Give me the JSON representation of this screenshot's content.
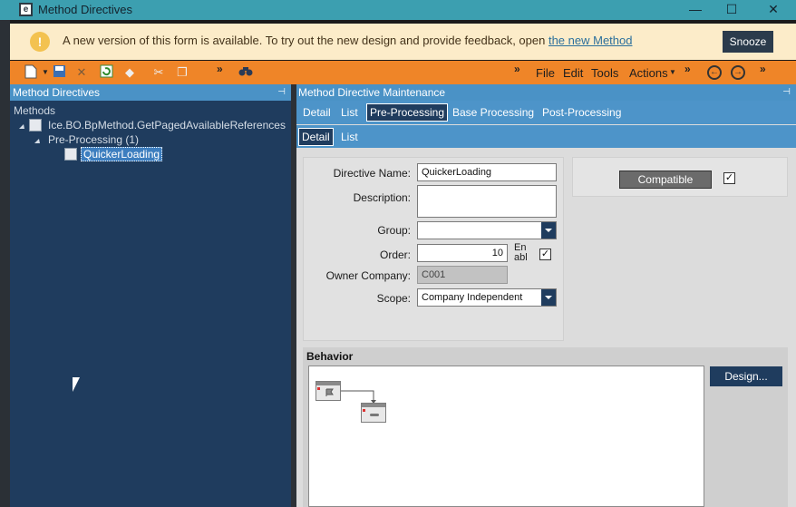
{
  "window": {
    "title": "Method Directives",
    "logo_letter": "e",
    "minimize": "—",
    "maximize": "☐",
    "close": "✕"
  },
  "notification": {
    "icon": "!",
    "message": "A new version of this form is available. To try out the new design and provide feedback, open ",
    "link_text": "the new Method",
    "snooze_label": "Snooze"
  },
  "toolbar": {
    "menus": [
      "File",
      "Edit",
      "Tools",
      "Actions"
    ],
    "overflow": "»"
  },
  "tree_panel": {
    "header": "Method Directives",
    "root_label": "Methods",
    "method_node": "Ice.BO.BpMethod.GetPagedAvailableReferences",
    "group_node": "Pre-Processing (1)",
    "directive_node": "QuickerLoading"
  },
  "main_panel": {
    "header": "Method Directive Maintenance",
    "tabs": [
      "Detail",
      "List",
      "Pre-Processing",
      "Base Processing",
      "Post-Processing"
    ],
    "subtabs": [
      "Detail",
      "List"
    ]
  },
  "form": {
    "directive_name_label": "Directive Name:",
    "directive_name_value": "QuickerLoading",
    "description_label": "Description:",
    "description_value": "",
    "group_label": "Group:",
    "group_value": "",
    "order_label": "Order:",
    "order_value": "10",
    "enabled_label": "En abl",
    "owner_company_label": "Owner Company:",
    "owner_company_value": "C001",
    "scope_label": "Scope:",
    "scope_value": "Company Independent",
    "compatible_label": "Compatible"
  },
  "behavior": {
    "title": "Behavior",
    "design_button": "Design..."
  }
}
